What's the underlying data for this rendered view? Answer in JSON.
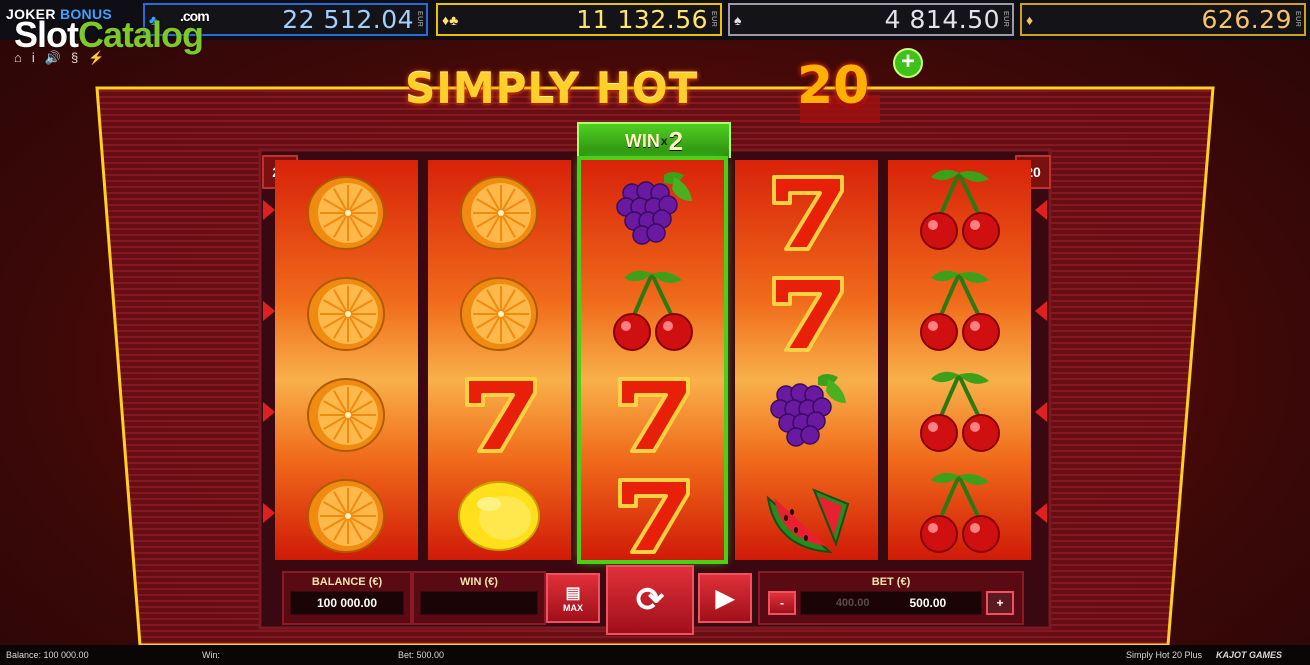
{
  "jackpots": [
    {
      "value": "22 512.04",
      "currency": "EUR",
      "suit": "♣"
    },
    {
      "value": "11 132.56",
      "currency": "EUR",
      "suit": "♦♣"
    },
    {
      "value": "4 814.50",
      "currency": "EUR",
      "suit": "♠"
    },
    {
      "value": "626.29",
      "currency": "EUR",
      "suit": "♦"
    }
  ],
  "brand": {
    "joker": "JOKER",
    "bonus": "BONUS",
    "watermark_a": "Slot",
    "watermark_b": "Catalog",
    "watermark_c": ".com"
  },
  "toolbar": {
    "home": "⌂",
    "info": "i",
    "sound": "🔊",
    "rules": "§",
    "turbo": "⚡"
  },
  "title": {
    "text": "SIMPLY HOT",
    "number": "20",
    "plus": "+"
  },
  "win_badge": {
    "prefix": "WIN",
    "x": "x",
    "mult": "2"
  },
  "badges": {
    "left": "20",
    "right": "20"
  },
  "reels": [
    [
      "orange",
      "orange",
      "orange",
      "orange"
    ],
    [
      "orange",
      "orange",
      "seven",
      "lemon"
    ],
    [
      "grapes",
      "cherries",
      "seven",
      "seven"
    ],
    [
      "seven",
      "seven",
      "grapes",
      "watermelon"
    ],
    [
      "cherries",
      "cherries",
      "cherries",
      "cherries"
    ]
  ],
  "panel": {
    "balance_label": "BALANCE (€)",
    "balance": "100 000.00",
    "win_label": "WIN (€)",
    "win": "",
    "max_label": "MAX",
    "bet_label": "BET (€)",
    "bet_prev": "400.00",
    "bet": "500.00",
    "minus": "-",
    "plus": "+"
  },
  "status": {
    "balance": "Balance: 100 000.00",
    "win": "Win:",
    "bet": "Bet: 500.00",
    "game": "Simply Hot 20 Plus",
    "provider": "KAJOT GAMES"
  },
  "colors": {
    "accent": "#ffcf2a",
    "win_green": "#4bd018",
    "reel_red": "#d8220a"
  }
}
